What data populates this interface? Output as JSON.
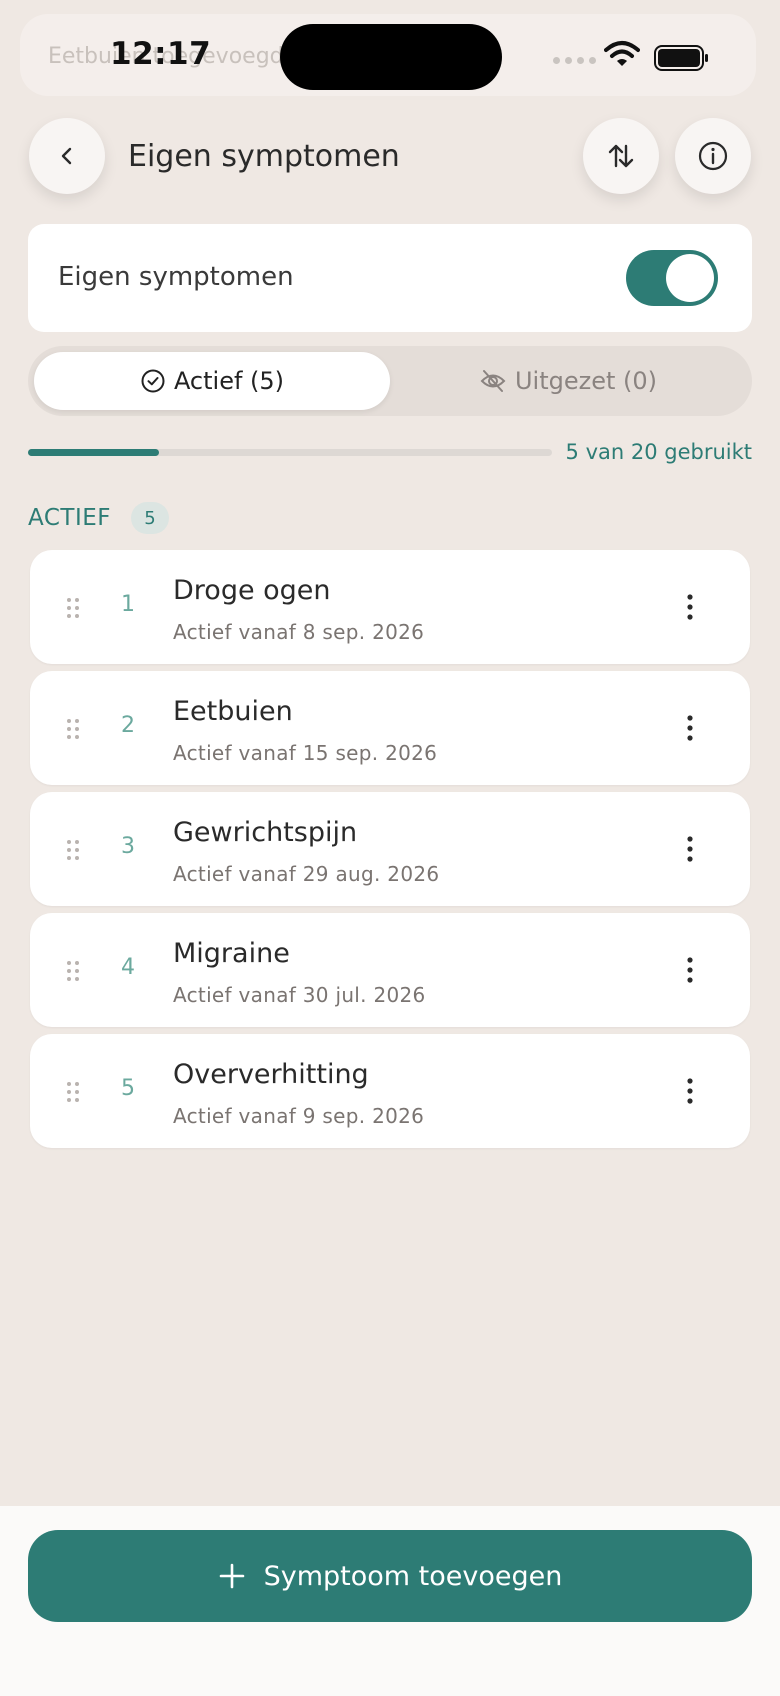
{
  "status_bar": {
    "time": "12:17",
    "toast_text": "Eetbuien toegevoegd"
  },
  "header": {
    "title": "Eigen symptomen",
    "back_icon": "chevron-left-icon",
    "sort_icon": "sort-arrows-icon",
    "info_icon": "info-icon"
  },
  "toggle": {
    "label": "Eigen symptomen",
    "on": true
  },
  "tabs": [
    {
      "label": "Actief (5)",
      "icon": "check-circle-icon",
      "active": true
    },
    {
      "label": "Uitgezet (0)",
      "icon": "eye-off-icon",
      "active": false
    }
  ],
  "usage": {
    "text": "5 van 20 gebruikt",
    "used": 5,
    "max": 20
  },
  "section": {
    "title": "ACTIEF",
    "count": "5"
  },
  "items": [
    {
      "num": "1",
      "title": "Droge ogen",
      "subtitle": "Actief vanaf 8 sep. 2026"
    },
    {
      "num": "2",
      "title": "Eetbuien",
      "subtitle": "Actief vanaf 15 sep. 2026"
    },
    {
      "num": "3",
      "title": "Gewrichtspijn",
      "subtitle": "Actief vanaf 29 aug. 2026"
    },
    {
      "num": "4",
      "title": "Migraine",
      "subtitle": "Actief vanaf 30 jul. 2026"
    },
    {
      "num": "5",
      "title": "Oververhitting",
      "subtitle": "Actief vanaf 9 sep. 2026"
    }
  ],
  "add_button": {
    "label": "Symptoom toevoegen",
    "icon": "plus-icon"
  },
  "colors": {
    "accent": "#2d7c75",
    "background": "#efe8e3"
  }
}
